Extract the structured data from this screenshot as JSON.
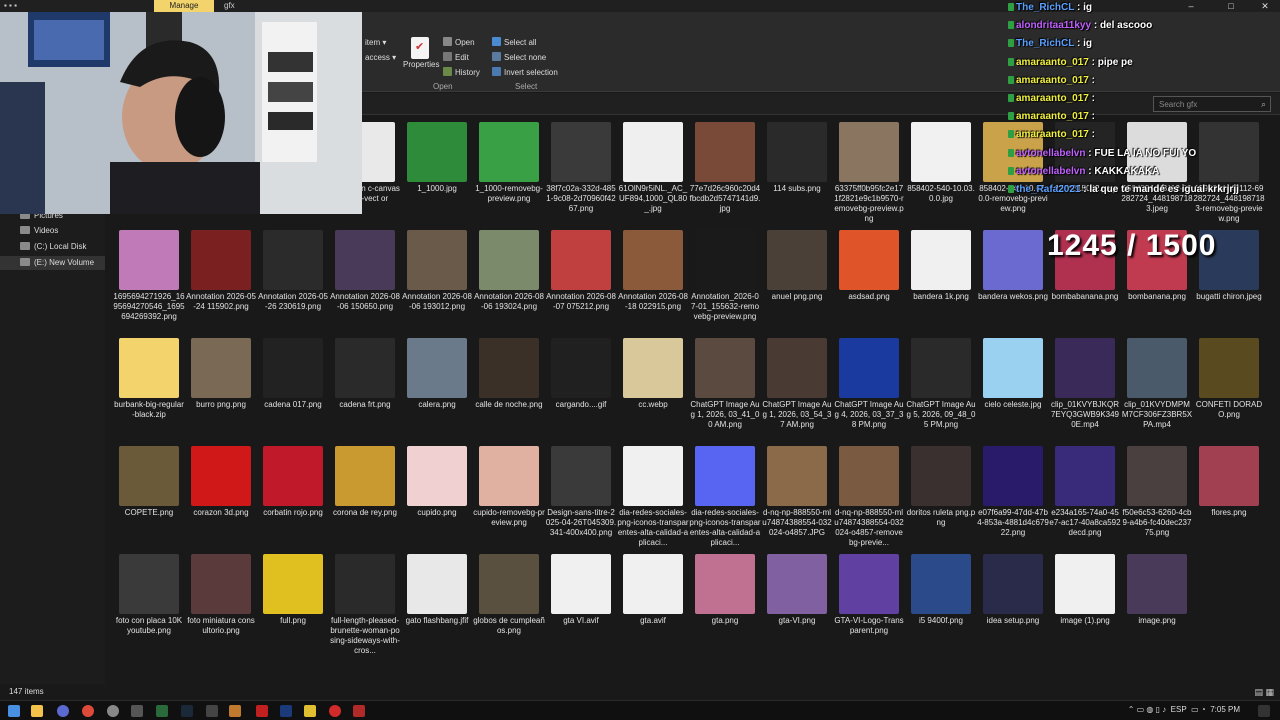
{
  "titlebar": {
    "manage_tab": "Manage",
    "window_title": "gfx",
    "controls": [
      "–",
      "□",
      "✕"
    ]
  },
  "ribbon": {
    "partial_items": [
      "item ▾",
      "access ▾"
    ],
    "properties_label": "Properties",
    "open_items": [
      "Open",
      "Edit",
      "History"
    ],
    "select_items": [
      "Select all",
      "Select none",
      "Invert selection"
    ],
    "group_open": "Open",
    "group_select": "Select"
  },
  "search": {
    "placeholder": "Search gfx",
    "icon": "search-icon"
  },
  "navpane": {
    "items": [
      {
        "label": "Pictures",
        "icon": "pictures-icon",
        "selected": false
      },
      {
        "label": "Videos",
        "icon": "videos-icon",
        "selected": false
      },
      {
        "label": "(C:) Local Disk",
        "icon": "drive-icon",
        "selected": false
      },
      {
        "label": "(E:) New Volume",
        "icon": "drive-icon",
        "selected": true
      }
    ]
  },
  "files": [
    {
      "name": "bang-blan c-canvas- sign-vect or",
      "color": "#e9e9e9"
    },
    {
      "name": "1_1000.jpg",
      "color": "#2e8b3a"
    },
    {
      "name": "1_1000-removebg-preview.png",
      "color": "#39a046"
    },
    {
      "name": "38f7c02a-332d-4851-9c08-2d70960f4267.png",
      "color": "#3a3a3a"
    },
    {
      "name": "61OlN9r5iNL._AC_UF894,1000_QL80_.jpg",
      "color": "#efefef"
    },
    {
      "name": "77e7d26c960c20d4fbcdb2d5747141d9.jpg",
      "color": "#7a4a38"
    },
    {
      "name": "114 subs.png",
      "color": "#2a2a2a"
    },
    {
      "name": "63375ff0b95fc2e171f2821e9c1b9570-removebg-preview.png",
      "color": "#8a7560"
    },
    {
      "name": "858402-540-10.03.0.0.jpg",
      "color": "#f1f1f1"
    },
    {
      "name": "858402-540-10.03.0.0-removebg-preview.png",
      "color": "#c9a24a"
    },
    {
      "name": "1576315042.png",
      "color": "#242424"
    },
    {
      "name": "1594324443112-69282724_4481987183.jpeg",
      "color": "#dcdcdc"
    },
    {
      "name": "1594324443112-69282724_4481987183-removebg-preview.png",
      "color": "#333333"
    },
    {
      "name": "1695694271926_1695694270546_1695694269392.png",
      "color": "#c07ab8"
    },
    {
      "name": "Annotation 2026-05-24 115902.png",
      "color": "#7a2020"
    },
    {
      "name": "Annotation 2026-05-26 230619.png",
      "color": "#2b2b2b"
    },
    {
      "name": "Annotation 2026-08-06 150650.png",
      "color": "#4a3a5a"
    },
    {
      "name": "Annotation 2026-08-06 193012.png",
      "color": "#6a5a4a"
    },
    {
      "name": "Annotation 2026-08-06 193024.png",
      "color": "#7a8a6a"
    },
    {
      "name": "Annotation 2026-08-07 075212.png",
      "color": "#c04040"
    },
    {
      "name": "Annotation 2026-08-18 022915.png",
      "color": "#8a5a3a"
    },
    {
      "name": "Annotation_2026-07-01_155632-removebg-preview.png",
      "color": "#1a1a1a"
    },
    {
      "name": "anuel png.png",
      "color": "#4a4038"
    },
    {
      "name": "asdsad.png",
      "color": "#e0542a"
    },
    {
      "name": "bandera 1k.png",
      "color": "#f0f0f0"
    },
    {
      "name": "bandera wekos.png",
      "color": "#6a6ad0"
    },
    {
      "name": "bombabanana.png",
      "color": "#b03050"
    },
    {
      "name": "bombanana.png",
      "color": "#c03a50"
    },
    {
      "name": "bugatti chiron.jpeg",
      "color": "#2a3a5a"
    },
    {
      "name": "burbank-big-regular-black.zip",
      "color": "#f3d36b"
    },
    {
      "name": "burro png.png",
      "color": "#7a6a55"
    },
    {
      "name": "cadena 017.png",
      "color": "#222222"
    },
    {
      "name": "cadena frt.png",
      "color": "#2a2a2a"
    },
    {
      "name": "calera.png",
      "color": "#6a7a8a"
    },
    {
      "name": "calle de noche.png",
      "color": "#3a3028"
    },
    {
      "name": "cargando....gif",
      "color": "#202020"
    },
    {
      "name": "cc.webp",
      "color": "#d8c89a"
    },
    {
      "name": "ChatGPT Image Aug 1, 2026, 03_41_00 AM.png",
      "color": "#5a4a40"
    },
    {
      "name": "ChatGPT Image Aug 1, 2026, 03_54_37 AM.png",
      "color": "#4a3a34"
    },
    {
      "name": "ChatGPT Image Aug 4, 2026, 03_37_38 PM.png",
      "color": "#1a3aa0"
    },
    {
      "name": "ChatGPT Image Aug 5, 2026, 09_48_05 PM.png",
      "color": "#2a2a2a"
    },
    {
      "name": "cielo celeste.jpg",
      "color": "#9ad0f0"
    },
    {
      "name": "clip_01KVYBJKQR7EYQ3GWB9K3490E.mp4",
      "color": "#3a2a5a"
    },
    {
      "name": "clip_01KVYDMPMM7CF306FZ3BR5XPA.mp4",
      "color": "#4a5a6a"
    },
    {
      "name": "CONFETI DORADO.png",
      "color": "#5a4a20"
    },
    {
      "name": "COPETE.png",
      "color": "#6a5a3a"
    },
    {
      "name": "corazon 3d.png",
      "color": "#d01818"
    },
    {
      "name": "corbatin rojo.png",
      "color": "#c01a2a"
    },
    {
      "name": "corona de rey.png",
      "color": "#c89a30"
    },
    {
      "name": "cupido.png",
      "color": "#f0d0d0"
    },
    {
      "name": "cupido-removebg-preview.png",
      "color": "#e0b0a0"
    },
    {
      "name": "Design-sans-titre-2025-04-26T045309.341-400x400.png",
      "color": "#3a3a3a"
    },
    {
      "name": "dia-redes-sociales-png-iconos-transparentes-alta-calidad-aplicaci...",
      "color": "#f0f0f0"
    },
    {
      "name": "dia-redes-sociales-png-iconos-transparentes-alta-calidad-aplicaci...",
      "color": "#5865f2"
    },
    {
      "name": "d-nq-np-888550-mlu74874388554-032024-o4857.JPG",
      "color": "#8a6a48"
    },
    {
      "name": "d-nq-np-888550-mlu74874388554-032024-o4857-removebg-previe...",
      "color": "#7a5a40"
    },
    {
      "name": "doritos ruleta png.png",
      "color": "#3a3030"
    },
    {
      "name": "e07f6a99-47dd-47b4-853a-4881d4c67922.png",
      "color": "#2a1a6a"
    },
    {
      "name": "e234a165-74a0-45e7-ac17-40a8ca592decd.png",
      "color": "#3a2a7a"
    },
    {
      "name": "f50e6c53-6260-4cb9-a4b6-fc40dec23775.png",
      "color": "#4a4040"
    },
    {
      "name": "flores.png",
      "color": "#a04050"
    },
    {
      "name": "foto con placa 10K youtube.png",
      "color": "#3a3a3a"
    },
    {
      "name": "foto miniatura consultorio.png",
      "color": "#5a3a3a"
    },
    {
      "name": "full.png",
      "color": "#e0c020"
    },
    {
      "name": "full-length-pleased-brunette-woman-posing-sideways-with-cros...",
      "color": "#2a2a2a"
    },
    {
      "name": "gato flashbang.jfif",
      "color": "#e8e8e8"
    },
    {
      "name": "globos de cumpleaños.png",
      "color": "#5a5040"
    },
    {
      "name": "gta VI.avif",
      "color": "#f0f0f0"
    },
    {
      "name": "gta.avif",
      "color": "#f0f0f0"
    },
    {
      "name": "gta.png",
      "color": "#c07090"
    },
    {
      "name": "gta-VI.png",
      "color": "#8060a0"
    },
    {
      "name": "GTA-VI-Logo-Transparent.png",
      "color": "#6040a0"
    },
    {
      "name": "i5 9400f.png",
      "color": "#2a4a8a"
    },
    {
      "name": "idea setup.png",
      "color": "#2a2a4a"
    },
    {
      "name": "image (1).png",
      "color": "#f0f0f0"
    },
    {
      "name": "image.png",
      "color": "#4a3a5a"
    }
  ],
  "status": {
    "item_count": "147 items"
  },
  "taskbar": {
    "lang": "ESP",
    "time": "7:05 PM"
  },
  "chat": [
    {
      "user": "The_RichCL",
      "msg": "ig",
      "color": "#5aa0ff"
    },
    {
      "user": "alondritaa11kyy",
      "msg": "del ascooo",
      "color": "#c060ff"
    },
    {
      "user": "The_RichCL",
      "msg": "ig",
      "color": "#5aa0ff"
    },
    {
      "user": "amaraanto_017",
      "msg": "pipe pe",
      "color": "#f0f040"
    },
    {
      "user": "amaraanto_017",
      "msg": "",
      "color": "#f0f040"
    },
    {
      "user": "amaraanto_017",
      "msg": "",
      "color": "#f0f040"
    },
    {
      "user": "amaraanto_017",
      "msg": "",
      "color": "#f0f040"
    },
    {
      "user": "amaraanto_017",
      "msg": "",
      "color": "#f0f040"
    },
    {
      "user": "avtonellabelvn",
      "msg": "FUE LA IA NO FUI YO",
      "color": "#c060ff"
    },
    {
      "user": "avtonellabelvn",
      "msg": "KAKKAKAKA",
      "color": "#c060ff"
    },
    {
      "user": "the_Rafa2021",
      "msg": "la que te mandé es igual krkrjrjj",
      "color": "#5aa0ff"
    }
  ],
  "goal_counter": "1245 / 1500"
}
